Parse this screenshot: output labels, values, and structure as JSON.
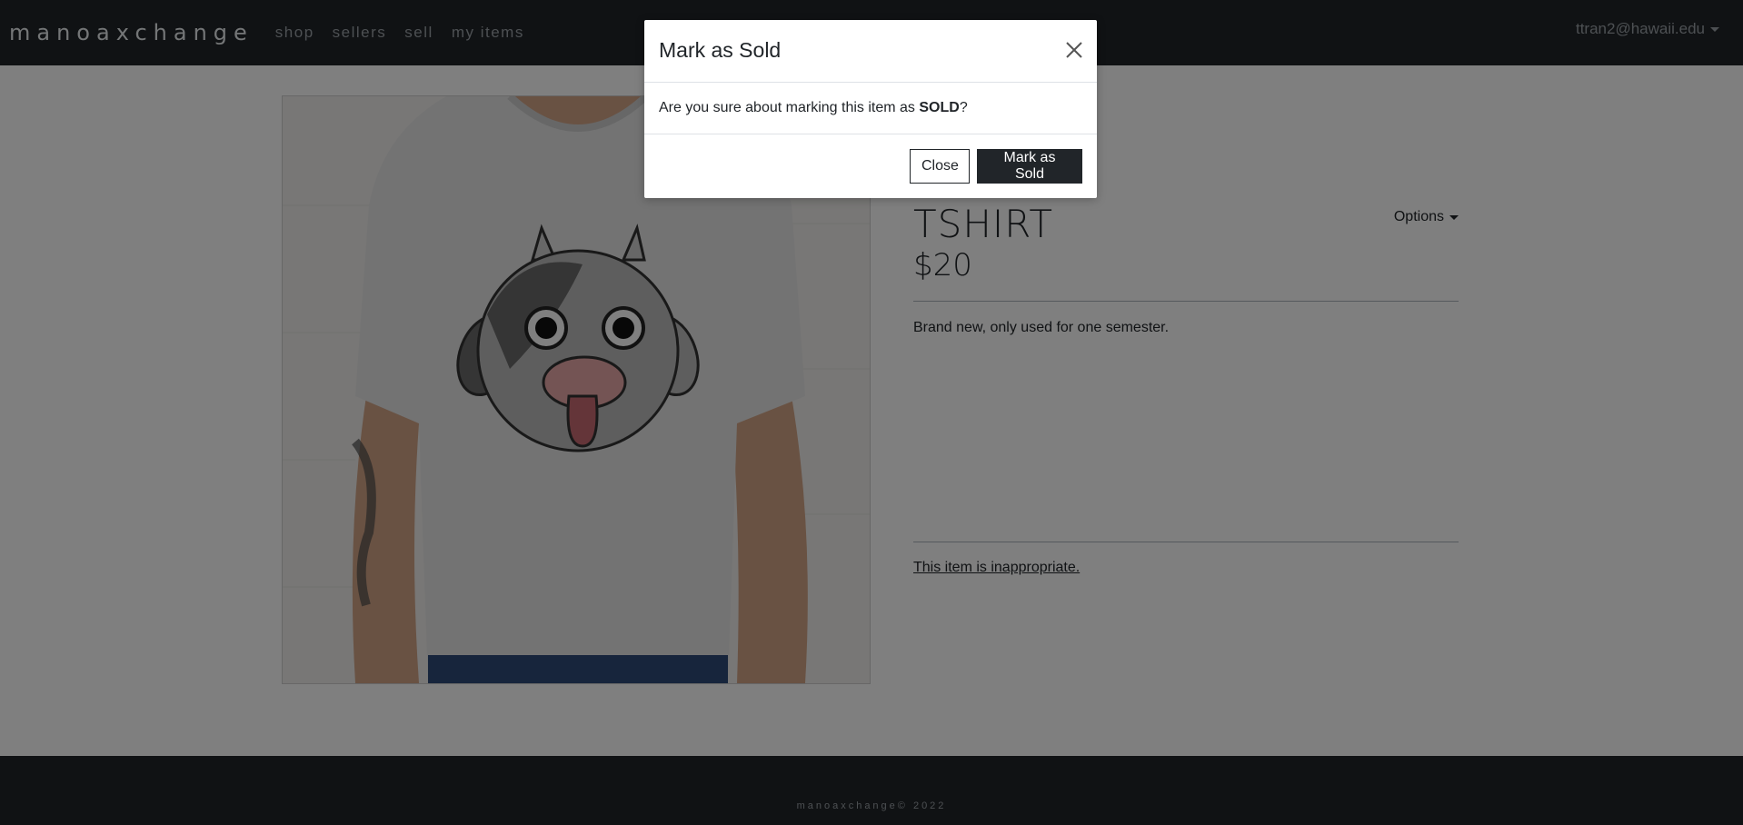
{
  "navbar": {
    "brand": "manoaxchange",
    "links": [
      "shop",
      "sellers",
      "sell",
      "my items"
    ],
    "user": "ttran2@hawaii.edu"
  },
  "item": {
    "title": "TSHIRT",
    "price": "$20",
    "options_label": "Options",
    "description": "Brand new, only used for one semester.",
    "report_link": "This item is inappropriate."
  },
  "footer": {
    "text": "manoaxchange© 2022"
  },
  "modal": {
    "title": "Mark as Sold",
    "message_prefix": "Are you sure about marking this item as ",
    "message_strong": "SOLD",
    "message_suffix": "?",
    "close_label": "Close",
    "confirm_label": "Mark as Sold"
  },
  "colors": {
    "navbar_bg": "#212529",
    "button_dark": "#212529",
    "backdrop": "rgba(0,0,0,0.5)"
  }
}
